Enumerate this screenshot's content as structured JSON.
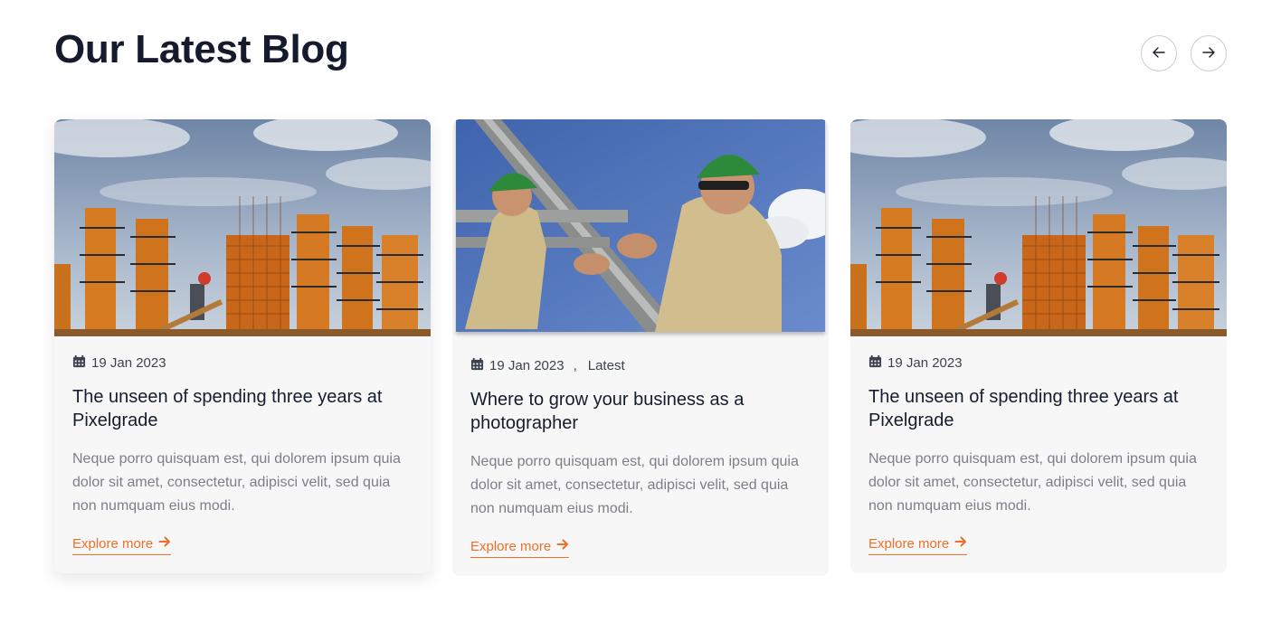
{
  "section": {
    "title": "Our Latest Blog",
    "prev_icon": "arrow-left-icon",
    "next_icon": "arrow-right-icon"
  },
  "colors": {
    "accent": "#ee6f2a",
    "heading": "#151b2d",
    "muted_text": "#7c7f87",
    "card_bg": "#f7f7f7"
  },
  "posts": [
    {
      "image": "construction-formwork-photo",
      "date": "19 Jan 2023",
      "category": "",
      "title": "The unseen of spending three years at Pixelgrade",
      "excerpt": "Neque porro quisquam est, qui dolorem ipsum quia dolor sit amet, consectetur, adipisci velit, sed quia non numquam eius modi.",
      "link_label": "Explore more"
    },
    {
      "image": "construction-workers-photo",
      "date": "19 Jan 2023",
      "category": "Latest",
      "title": "Where to grow your business as a photographer",
      "excerpt": "Neque porro quisquam est, qui dolorem ipsum quia dolor sit amet, consectetur, adipisci velit, sed quia non numquam eius modi.",
      "link_label": "Explore more"
    },
    {
      "image": "construction-formwork-photo",
      "date": "19 Jan 2023",
      "category": "",
      "title": "The unseen of spending three years at Pixelgrade",
      "excerpt": "Neque porro quisquam est, qui dolorem ipsum quia dolor sit amet, consectetur, adipisci velit, sed quia non numquam eius modi.",
      "link_label": "Explore more"
    }
  ]
}
